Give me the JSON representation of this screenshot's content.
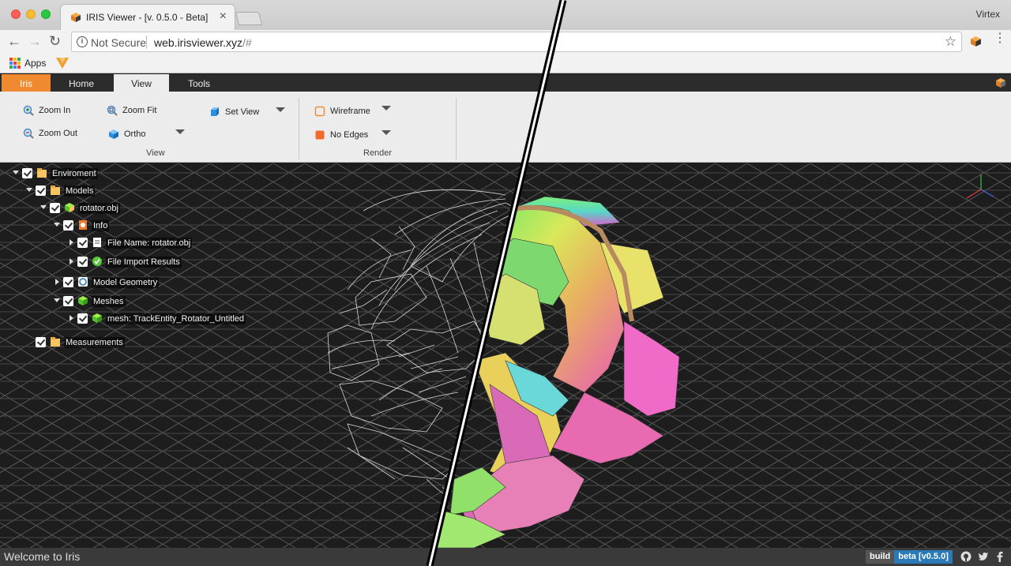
{
  "browser": {
    "tab_title": "IRIS Viewer - [v. 0.5.0 - Beta]",
    "tab_close": "×",
    "profile_name": "Virtex",
    "security_label": "Not Secure",
    "url_host": "web.irisviewer.xyz",
    "url_path": "/#",
    "bookmarks": {
      "apps_label": "Apps"
    },
    "icons": [
      "back-icon",
      "forward-icon",
      "reload-icon",
      "info-icon",
      "star-icon",
      "extension-cube-icon",
      "menu-icon",
      "apps-grid-icon",
      "vue-bookmark-icon"
    ]
  },
  "ribbon": {
    "tabs": [
      {
        "label": "Iris",
        "active": false
      },
      {
        "label": "Home",
        "active": false
      },
      {
        "label": "View",
        "active": true
      },
      {
        "label": "Tools",
        "active": false
      }
    ],
    "view_group": {
      "label": "View",
      "zoom_in": "Zoom In",
      "zoom_fit": "Zoom Fit",
      "set_view": "Set View",
      "zoom_out": "Zoom Out",
      "ortho": "Ortho"
    },
    "render_group": {
      "label": "Render",
      "wireframe": "Wireframe",
      "no_edges": "No Edges"
    }
  },
  "tree": [
    {
      "label": "Enviroment",
      "expanded": true,
      "icon": "folder-icon"
    },
    {
      "label": "Models",
      "expanded": true,
      "icon": "folder-icon"
    },
    {
      "label": "rotator.obj",
      "expanded": true,
      "icon": "model-icon"
    },
    {
      "label": "Info",
      "expanded": true,
      "icon": "info-doc-icon"
    },
    {
      "label": "File Name: rotator.obj",
      "expanded": false,
      "icon": "file-icon"
    },
    {
      "label": "File Import Results",
      "expanded": false,
      "icon": "check-circle-icon"
    },
    {
      "label": "Model Geometry",
      "expanded": false,
      "icon": "geometry-icon"
    },
    {
      "label": "Meshes",
      "expanded": true,
      "icon": "cube-icon"
    },
    {
      "label": "mesh: TrackEntity_Rotator_Untitled",
      "expanded": false,
      "icon": "cube-icon"
    },
    {
      "label": "Measurements",
      "expanded": null,
      "icon": "folder-icon"
    }
  ],
  "status": {
    "message": "Welcome to Iris",
    "build_label": "build",
    "build_version": "beta [v0.5.0]",
    "social_icons": [
      "github-icon",
      "twitter-icon",
      "facebook-icon"
    ]
  },
  "colors": {
    "iris_orange": "#f08a30",
    "ribbon_bg": "#ececec",
    "viewport_bg": "#1d1d1d",
    "grid_line": "#5a5a5a",
    "badge_blue": "#2a7ab8"
  }
}
